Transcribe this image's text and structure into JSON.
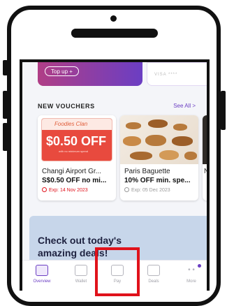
{
  "wallet": {
    "topup_label": "Top up +",
    "card_hint": "VISA ****"
  },
  "vouchers": {
    "section_title": "NEW VOUCHERS",
    "see_all": "See All >",
    "items": [
      {
        "brand": "Changi Airport Gr...",
        "desc": "S$0.50 OFF no mi...",
        "expiry": "Exp: 14 Nov 2023",
        "expiry_color": "#e0121b",
        "image_brand": "Foodies Clan",
        "image_value": "$0.50 OFF",
        "image_note": "with no minimum spend"
      },
      {
        "brand": "Paris Baguette",
        "desc": "10% OFF min. spe...",
        "expiry": "Exp: 05 Dec 2023",
        "expiry_color": "#999999"
      },
      {
        "brand": "N",
        "desc": "",
        "expiry": ""
      }
    ]
  },
  "banner": {
    "text": "Check out today's amazing deals!"
  },
  "nav": {
    "items": [
      {
        "label": "Overview",
        "active": true
      },
      {
        "label": "Wallet"
      },
      {
        "label": "Pay"
      },
      {
        "label": "Deals"
      },
      {
        "label": "More"
      }
    ]
  },
  "colors": {
    "accent": "#6b3ec3",
    "highlight": "#e0121b"
  }
}
